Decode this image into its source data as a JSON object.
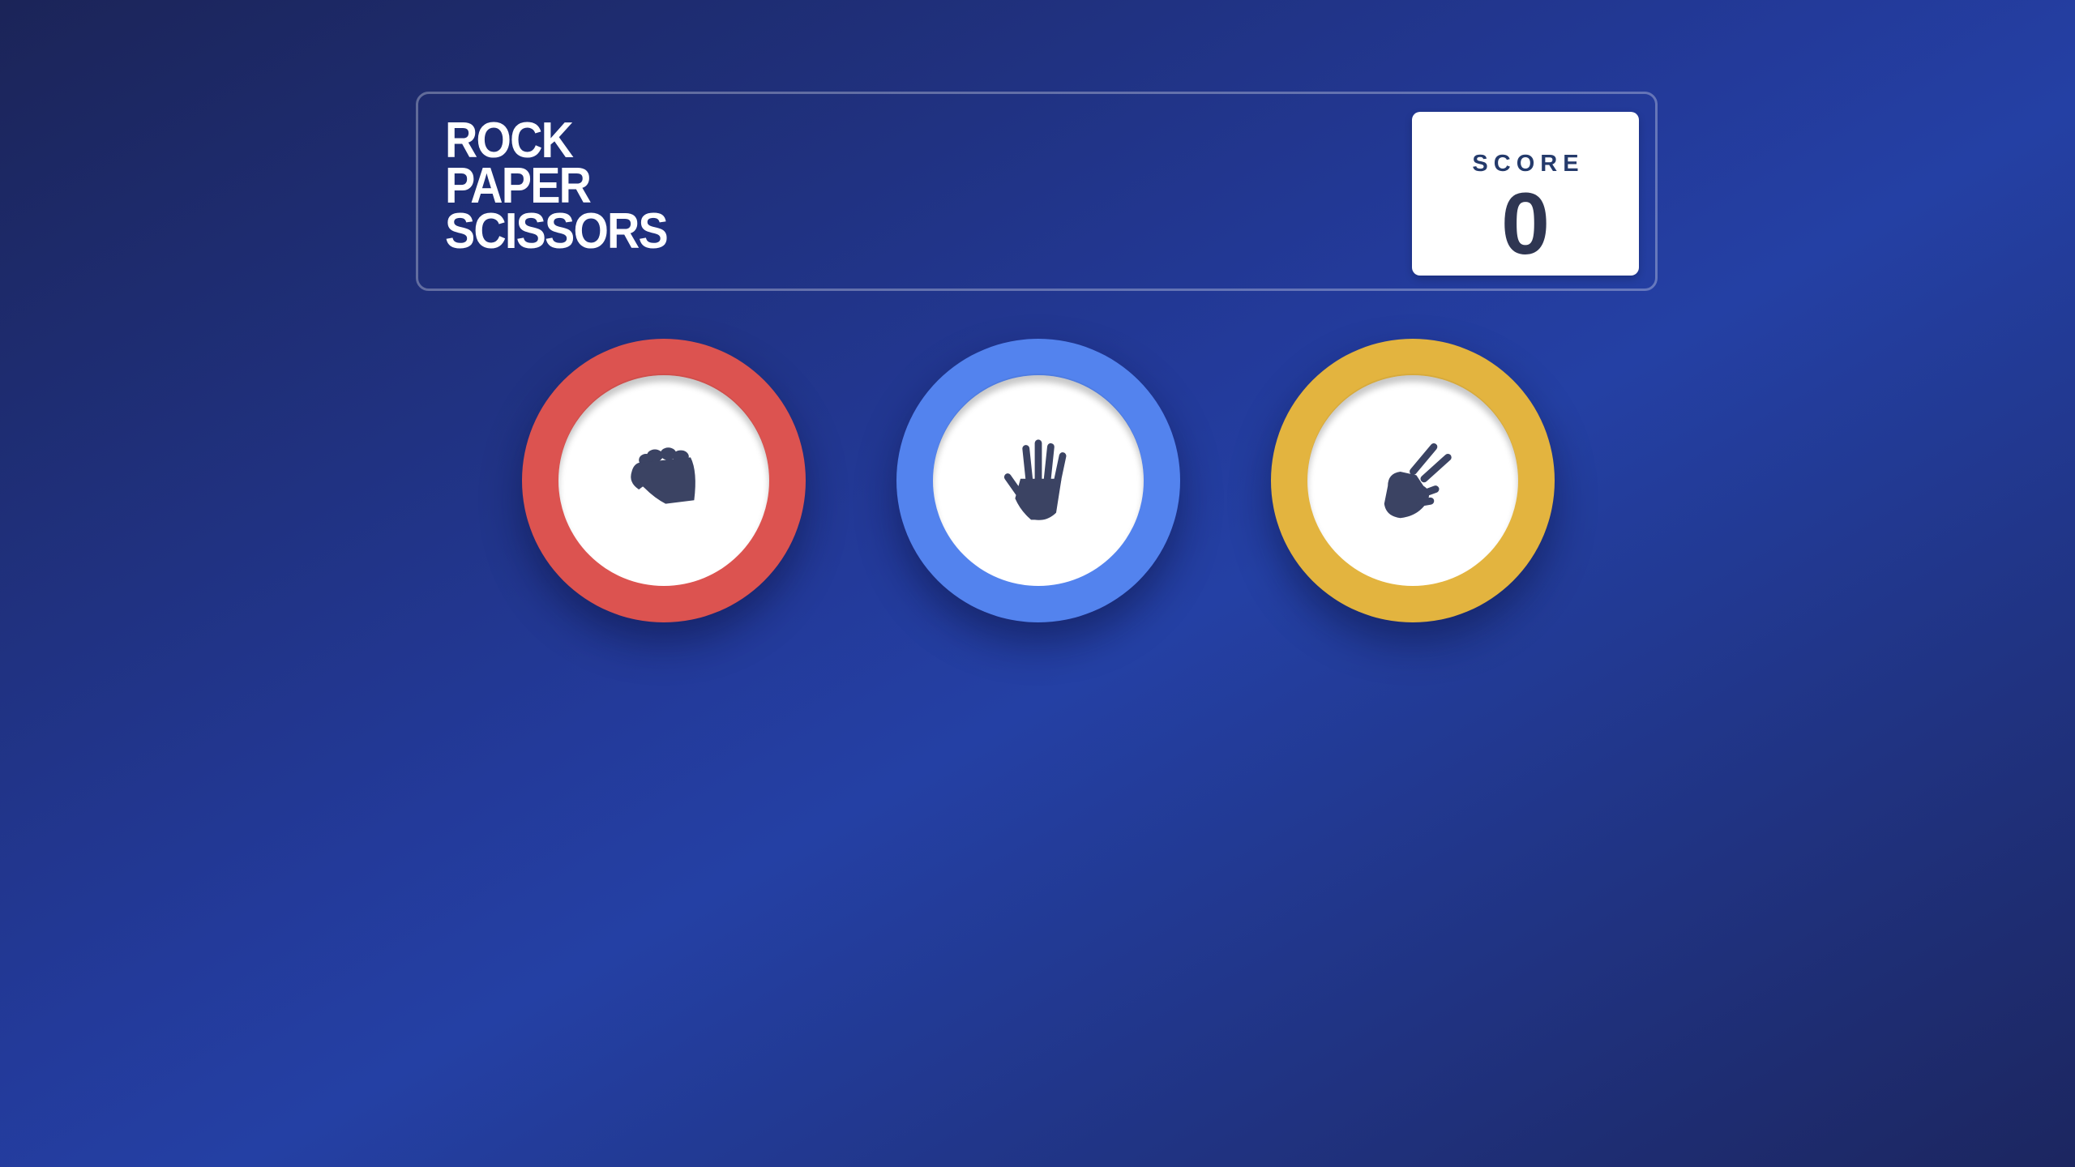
{
  "header": {
    "title_lines": [
      "ROCK",
      "PAPER",
      "SCISSORS"
    ],
    "score_label": "SCORE",
    "score_value": "0"
  },
  "choices": [
    {
      "id": "rock",
      "icon": "fist-icon",
      "ring_color": "#dc5350"
    },
    {
      "id": "paper",
      "icon": "open-hand-icon",
      "ring_color": "#5383ee"
    },
    {
      "id": "scissors",
      "icon": "scissors-hand-icon",
      "ring_color": "#e3b43f"
    }
  ],
  "colors": {
    "icon": "#3b4363",
    "background_dark": "#1b2458",
    "background_light": "#2440a4"
  }
}
